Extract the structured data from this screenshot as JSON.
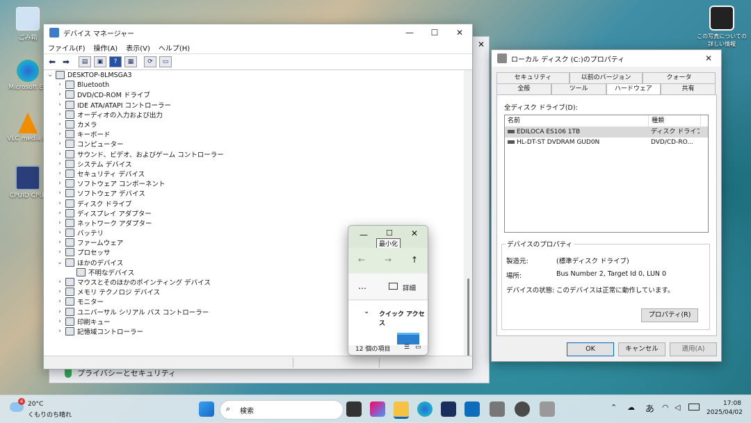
{
  "desktop": {
    "icons": [
      {
        "label": "ごみ箱"
      },
      {
        "label": "Microsoft Ed"
      },
      {
        "label": "VLC media pl"
      },
      {
        "label": "CPUID CPU-"
      }
    ],
    "right_icon": {
      "label": "この写真についての詳しい情報"
    }
  },
  "back_window": {
    "privacy_label": "プライバシーとセキュリティ"
  },
  "device_manager": {
    "title": "デバイス マネージャー",
    "menu": [
      "ファイル(F)",
      "操作(A)",
      "表示(V)",
      "ヘルプ(H)"
    ],
    "toolbar_icons": [
      "back-arrow-icon",
      "forward-arrow-icon",
      "properties-icon",
      "update-driver-icon",
      "help-icon",
      "view-icon",
      "scan-icon",
      "monitor-icon"
    ],
    "root": "DESKTOP-8LMSGA3",
    "nodes": [
      {
        "label": "Bluetooth",
        "expanded": false
      },
      {
        "label": "DVD/CD-ROM ドライブ",
        "expanded": false
      },
      {
        "label": "IDE ATA/ATAPI コントローラー",
        "expanded": false
      },
      {
        "label": "オーディオの入力および出力",
        "expanded": false
      },
      {
        "label": "カメラ",
        "expanded": false
      },
      {
        "label": "キーボード",
        "expanded": false
      },
      {
        "label": "コンピューター",
        "expanded": false
      },
      {
        "label": "サウンド、ビデオ、およびゲーム コントローラー",
        "expanded": false
      },
      {
        "label": "システム デバイス",
        "expanded": false
      },
      {
        "label": "セキュリティ デバイス",
        "expanded": false
      },
      {
        "label": "ソフトウェア コンポーネント",
        "expanded": false
      },
      {
        "label": "ソフトウェア デバイス",
        "expanded": false
      },
      {
        "label": "ディスク ドライブ",
        "expanded": false
      },
      {
        "label": "ディスプレイ アダプター",
        "expanded": false
      },
      {
        "label": "ネットワーク アダプター",
        "expanded": false
      },
      {
        "label": "バッテリ",
        "expanded": false
      },
      {
        "label": "ファームウェア",
        "expanded": false
      },
      {
        "label": "プロセッサ",
        "expanded": false
      },
      {
        "label": "ほかのデバイス",
        "expanded": true
      },
      {
        "label": "不明なデバイス",
        "child": true
      },
      {
        "label": "マウスとそのほかのポインティング デバイス",
        "expanded": false
      },
      {
        "label": "メモリ テクノロジ デバイス",
        "expanded": false
      },
      {
        "label": "モニター",
        "expanded": false
      },
      {
        "label": "ユニバーサル シリアル バス コントローラー",
        "expanded": false
      },
      {
        "label": "印刷キュー",
        "expanded": false
      },
      {
        "label": "記憶域コントローラー",
        "expanded": false
      }
    ]
  },
  "properties": {
    "title": "ローカル ディスク (C:)のプロパティ",
    "tabs_top": [
      "セキュリティ",
      "以前のバージョン",
      "クォータ"
    ],
    "tabs_bottom": [
      "全般",
      "ツール",
      "ハードウェア",
      "共有"
    ],
    "active_tab": "ハードウェア",
    "list_label": "全ディスク ドライブ(D):",
    "col_name": "名前",
    "col_type": "種類",
    "drives": [
      {
        "name": "EDILOCA ES106 1TB",
        "type": "ディスク ドライブ",
        "selected": true
      },
      {
        "name": "HL-DT-ST DVDRAM GUD0N",
        "type": "DVD/CD-RO...",
        "selected": false
      }
    ],
    "group_label": "デバイスのプロパティ",
    "fields": [
      {
        "key": "製造元:",
        "value": "(標準ディスク ドライブ)"
      },
      {
        "key": "場所:",
        "value": "Bus Number 2, Target Id 0, LUN 0"
      },
      {
        "key": "デバイスの状態:",
        "value": "このデバイスは正常に動作しています。"
      }
    ],
    "props_button": "プロパティ(R)",
    "ok": "OK",
    "cancel": "キャンセル",
    "apply": "適用(A)"
  },
  "mini_explorer": {
    "tooltip": "最小化",
    "details": "詳細",
    "quick_access": "クイック アクセス",
    "item_count": "12 個の項目"
  },
  "taskbar": {
    "weather_temp": "20°C",
    "weather_desc": "くもりのち晴れ",
    "weather_badge": "4",
    "search_placeholder": "検索",
    "ime": "あ",
    "time": "17:08",
    "date": "2025/04/02"
  }
}
